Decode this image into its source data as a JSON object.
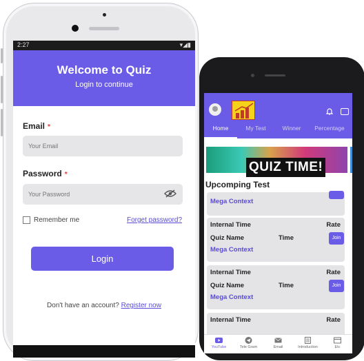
{
  "login": {
    "status_time": "2:27",
    "title": "Welcome to Quiz",
    "subtitle": "Login to continue",
    "email_label": "Email",
    "email_placeholder": "Your Email",
    "password_label": "Password",
    "password_placeholder": "Your Password",
    "required_mark": "*",
    "remember_label": "Remember me",
    "forget_link": "Forget password?",
    "login_button": "Login",
    "no_account_text": "Don't have an account?",
    "register_link": "Register now"
  },
  "app": {
    "tabs": [
      "Home",
      "My Test",
      "Winner",
      "Percentage"
    ],
    "active_tab": "Home",
    "banner_text": "QUIZ TIME!",
    "section_title": "Upcomping Test",
    "partial_card": {
      "mega": "Mega Context"
    },
    "cards": [
      {
        "internal": "Internal Time",
        "rate": "Rate",
        "quiz_name": "Quiz Name",
        "time": "Time",
        "join": "Join",
        "mega": "Mega Context"
      },
      {
        "internal": "Internal Time",
        "rate": "Rate",
        "quiz_name": "Quiz Name",
        "time": "Time",
        "join": "Join",
        "mega": "Mega Context"
      },
      {
        "internal": "Internal Time",
        "rate": "Rate"
      }
    ],
    "bottom_nav": [
      "YouTube",
      "Tele Gram",
      "Email",
      "Introduction",
      "Etc"
    ]
  },
  "colors": {
    "primary": "#6b5ce7",
    "link": "#5a4ad6",
    "required": "#e53935"
  }
}
